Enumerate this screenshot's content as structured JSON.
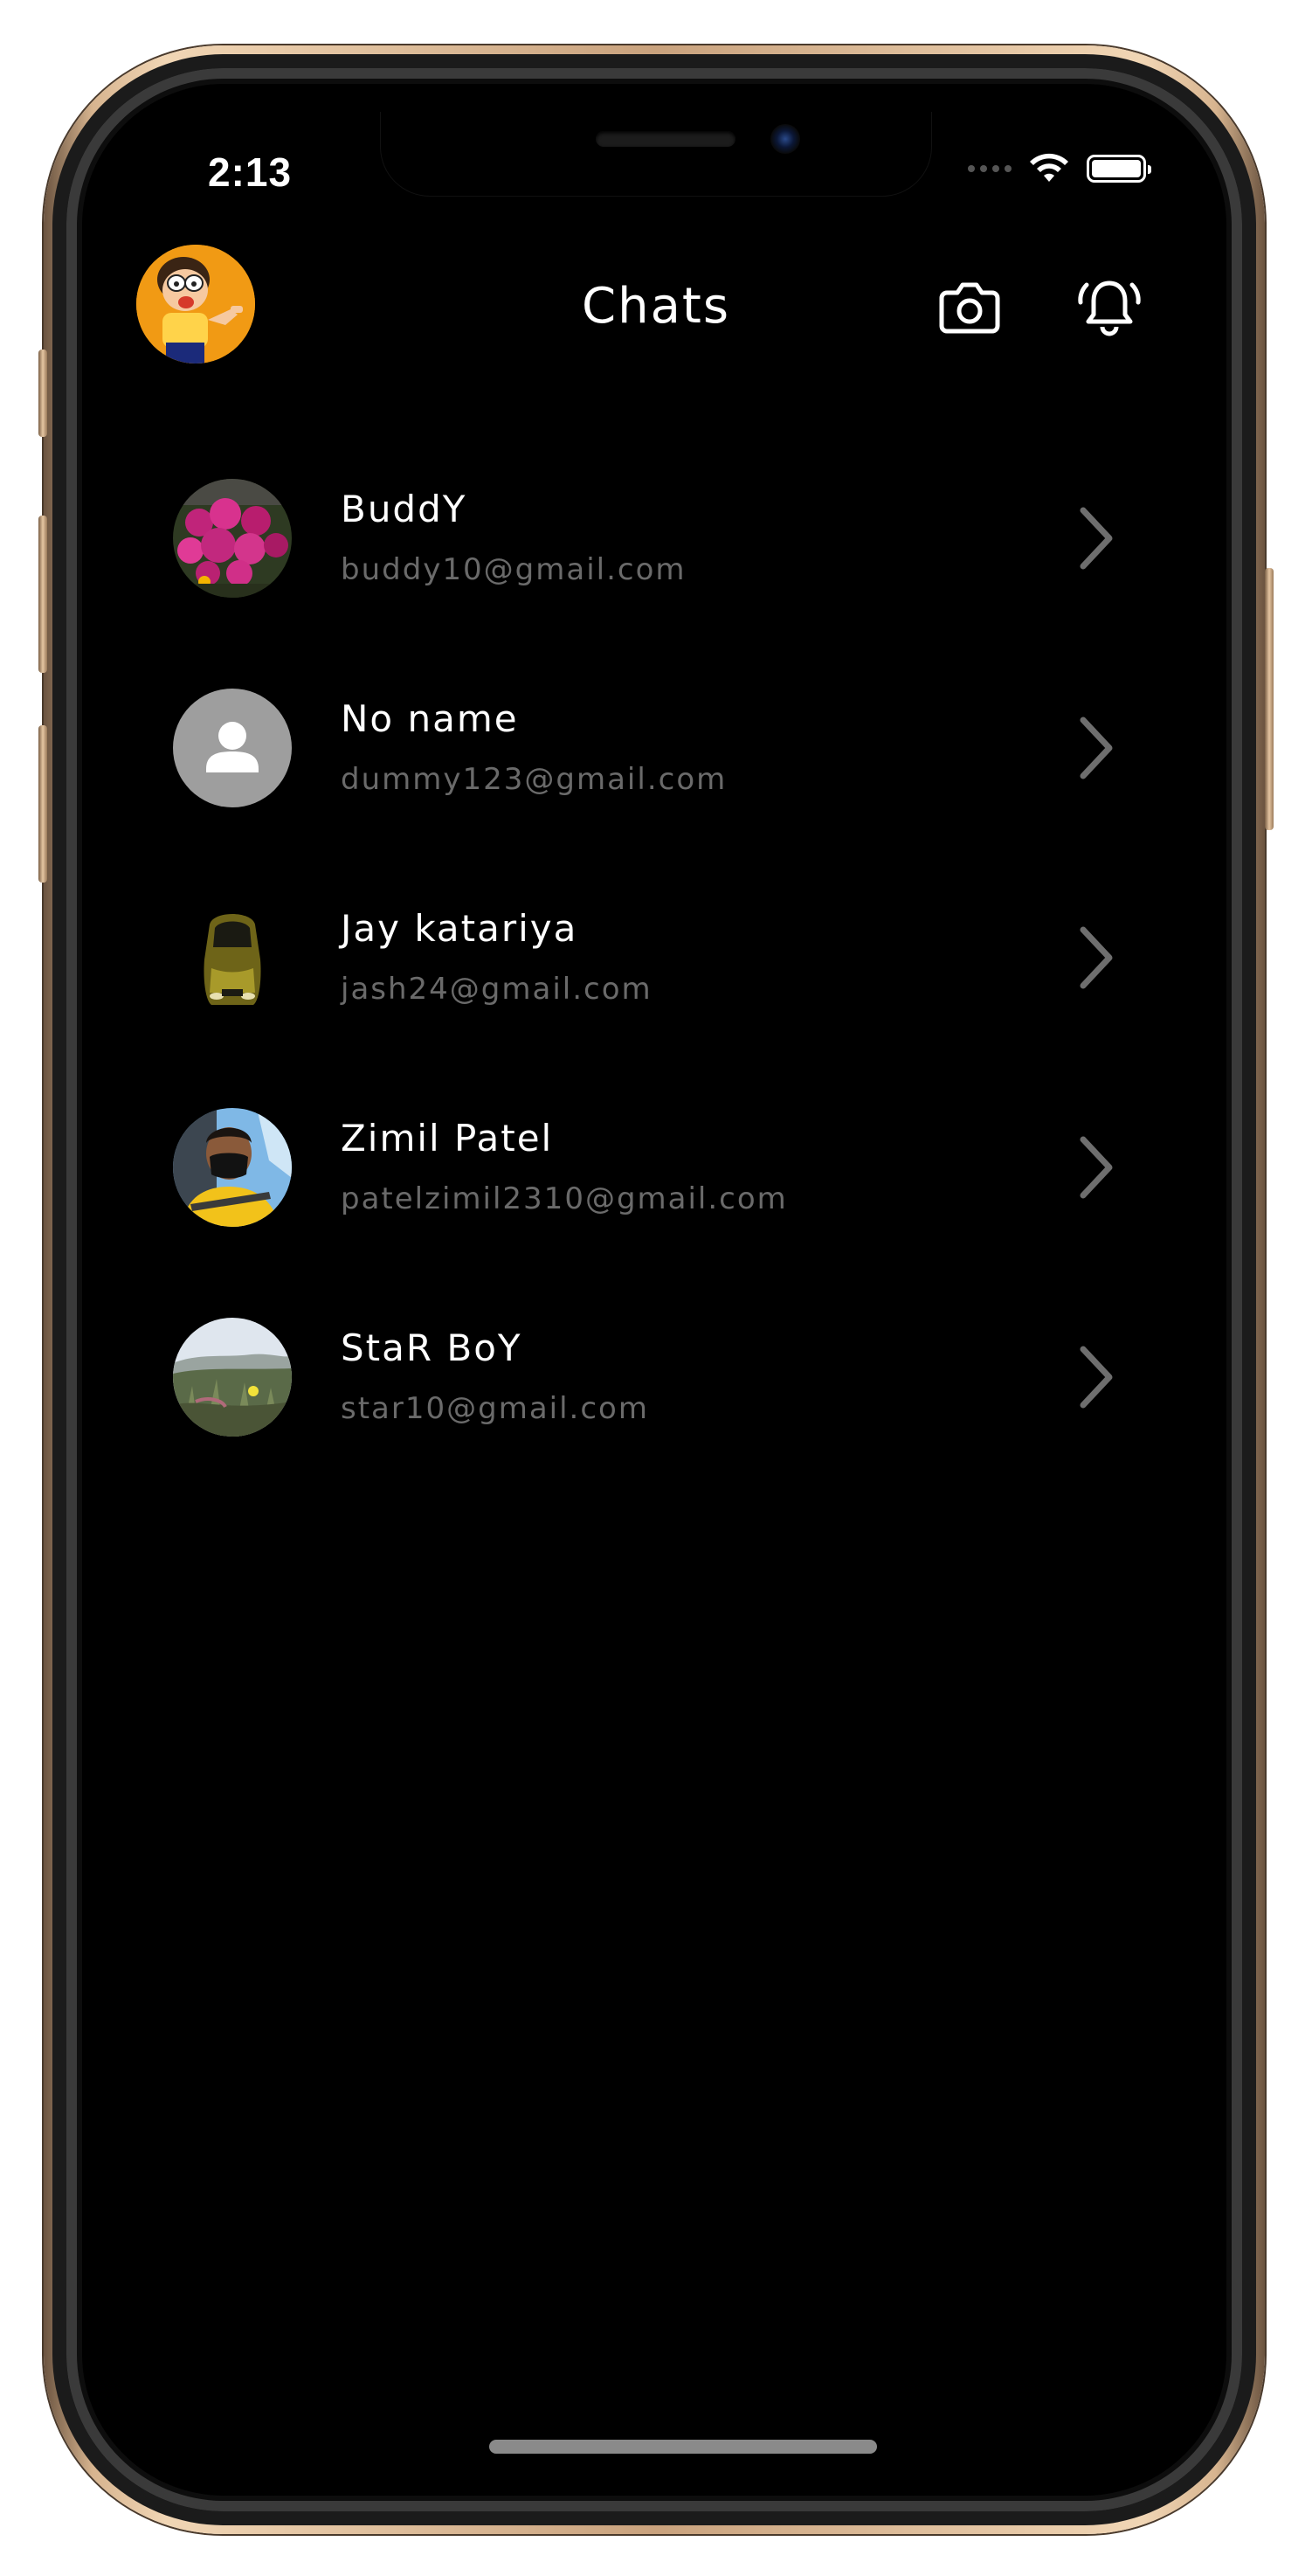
{
  "status_bar": {
    "time": "2:13",
    "wifi_icon": "wifi-icon",
    "battery_icon": "battery-full-icon"
  },
  "header": {
    "title": "Chats",
    "profile_avatar": "profile-avatar",
    "camera_icon": "camera-icon",
    "notification_icon": "bell-ringing-icon"
  },
  "chats": [
    {
      "name": "BuddY",
      "email": "buddy10@gmail.com",
      "avatar": "flower-photo"
    },
    {
      "name": "No name",
      "email": "dummy123@gmail.com",
      "avatar": "default-person-icon"
    },
    {
      "name": "Jay katariya",
      "email": "jash24@gmail.com",
      "avatar": "car-photo"
    },
    {
      "name": "Zimil Patel",
      "email": "patelzimil2310@gmail.com",
      "avatar": "person-photo"
    },
    {
      "name": "StaR BoY",
      "email": "star10@gmail.com",
      "avatar": "landscape-photo"
    }
  ],
  "colors": {
    "background": "#000000",
    "primary_text": "#ffffff",
    "secondary_text": "#6a6a6a",
    "chevron": "#6e6e6e",
    "profile_avatar_bg": "#f19a14",
    "placeholder_avatar_bg": "#9e9e9e",
    "frame_gold": "#d7b48f"
  }
}
